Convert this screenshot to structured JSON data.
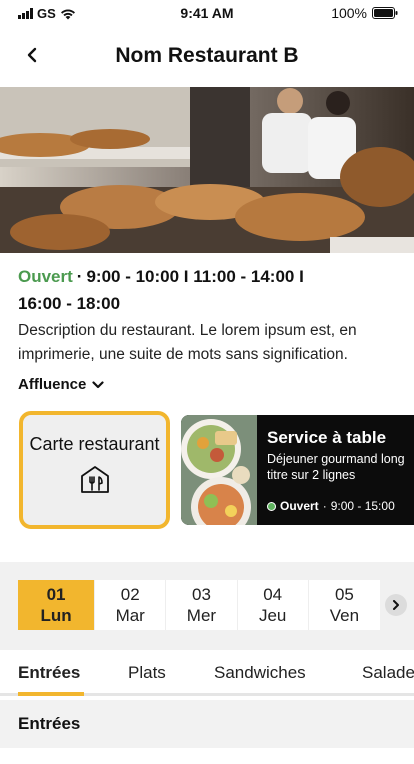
{
  "status_bar": {
    "carrier": "GS",
    "time": "9:41 AM",
    "battery": "100%"
  },
  "header": {
    "title": "Nom Restaurant B"
  },
  "info": {
    "status": "Ouvert",
    "separator": "·",
    "hours_line1": "9:00 - 10:00 I 11:00 - 14:00 I",
    "hours_line2": "16:00 - 18:00",
    "description": "Description du restaurant. Le lorem ipsum est, en imprimerie, une suite de mots sans signification.",
    "affluence": "Affluence"
  },
  "cards": {
    "carte_label": "Carte restaurant",
    "service": {
      "title": "Service à table",
      "subtitle": "Déjeuner gourmand long titre sur 2 lignes",
      "status": "Ouvert",
      "separator": "·",
      "hours": "9:00 - 15:00"
    }
  },
  "dates": [
    {
      "num": "01",
      "day": "Lun"
    },
    {
      "num": "02",
      "day": "Mar"
    },
    {
      "num": "03",
      "day": "Mer"
    },
    {
      "num": "04",
      "day": "Jeu"
    },
    {
      "num": "05",
      "day": "Ven"
    }
  ],
  "tabs": [
    "Entrées",
    "Plats",
    "Sandwiches",
    "Salades"
  ],
  "section": {
    "title": "Entrées"
  },
  "colors": {
    "accent": "#f2b62e",
    "open_green": "#4b9a4f"
  }
}
